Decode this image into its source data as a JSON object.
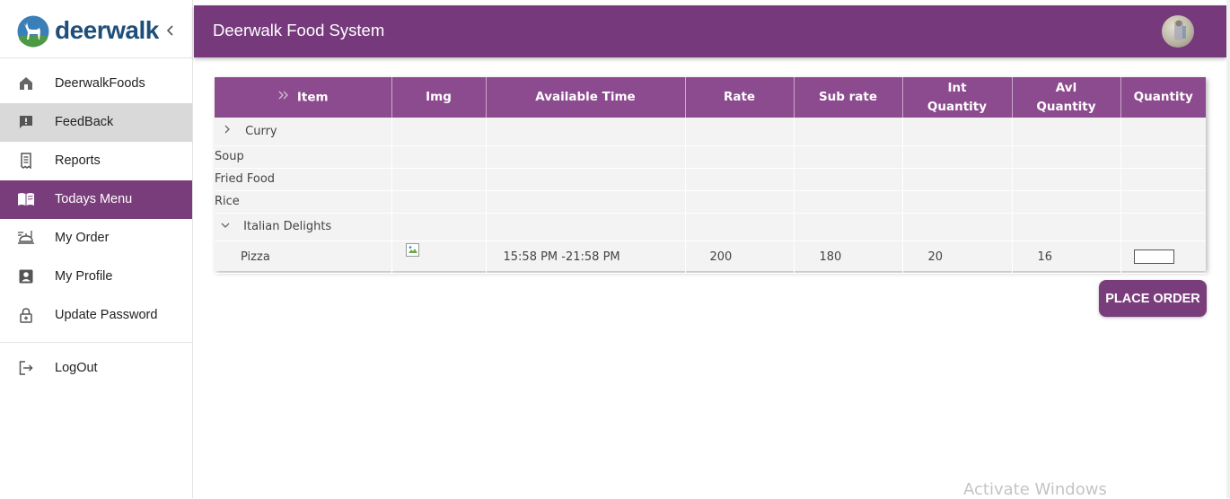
{
  "brand": {
    "name": "deerwalk"
  },
  "header": {
    "title": "Deerwalk Food System"
  },
  "sidebar": {
    "items": [
      {
        "label": "DeerwalkFoods",
        "icon": "home-icon"
      },
      {
        "label": "FeedBack",
        "icon": "feedback-icon"
      },
      {
        "label": "Reports",
        "icon": "receipt-icon"
      },
      {
        "label": "Todays Menu",
        "icon": "menu-book-icon"
      },
      {
        "label": "My Order",
        "icon": "order-tray-icon"
      },
      {
        "label": "My Profile",
        "icon": "profile-icon"
      },
      {
        "label": "Update Password",
        "icon": "lock-icon"
      }
    ],
    "logout": {
      "label": "LogOut",
      "icon": "logout-icon"
    }
  },
  "table": {
    "columns": [
      "Item",
      "Img",
      "Available Time",
      "Rate",
      "Sub rate",
      "Int Quantity",
      "Avl Quantity",
      "Quantity"
    ],
    "groups": [
      {
        "name": "Curry",
        "expanded": false
      },
      {
        "name": "Soup"
      },
      {
        "name": "Fried Food"
      },
      {
        "name": "Rice"
      },
      {
        "name": "Italian Delights",
        "expanded": true
      }
    ],
    "item": {
      "name": "Pizza",
      "available_time": "15:58 PM -21:58 PM",
      "rate": "200",
      "sub_rate": "180",
      "int_quantity": "20",
      "avl_quantity": "16",
      "quantity": ""
    }
  },
  "actions": {
    "place_order_label": "PLACE ORDER"
  },
  "watermark": "Activate Windows",
  "colors": {
    "primary": "#763a7c",
    "header_cell": "#8c4b8e",
    "active_nav": "#7a3d7c"
  }
}
